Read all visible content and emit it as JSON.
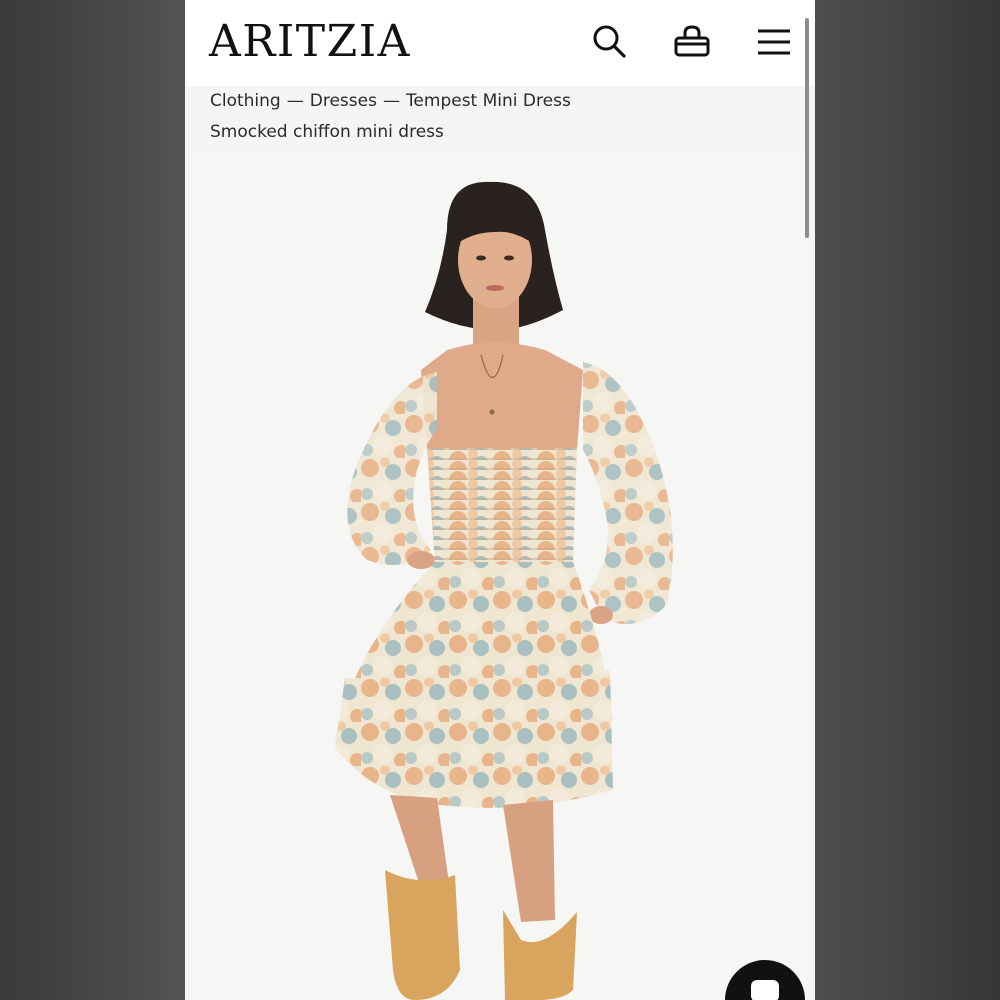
{
  "brand": {
    "logo_text": "ARITZIA"
  },
  "header": {
    "icons": [
      "search-icon",
      "bag-icon",
      "menu-icon"
    ]
  },
  "breadcrumb": {
    "items": [
      "Clothing",
      "Dresses",
      "Tempest Mini Dress"
    ],
    "separator": "—"
  },
  "product": {
    "subtitle": "Smocked chiffon mini dress"
  },
  "colors": {
    "background_outer": "#4e4e4c",
    "page_bg": "#f5f5f4",
    "text": "#2a2a2a",
    "dress_peach": "#e8b48a",
    "dress_blue": "#a9bfc0",
    "dress_cream": "#efe6d2",
    "boots": "#d9a45e"
  }
}
